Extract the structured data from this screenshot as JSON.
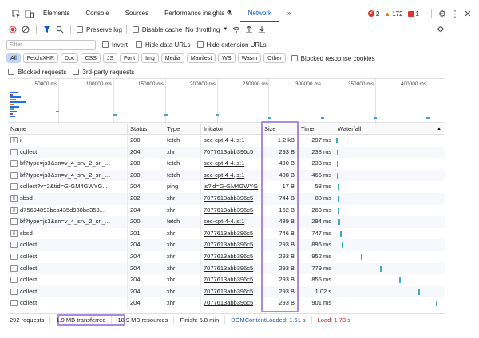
{
  "tabs": [
    "Elements",
    "Console",
    "Sources",
    "Performance insights ⚗",
    "Network"
  ],
  "active_tab": "Network",
  "more_tabs": "»",
  "badges": {
    "errors": "2",
    "warnings": "172",
    "issues": "1"
  },
  "toolbar": {
    "preserve_log": "Preserve log",
    "disable_cache": "Disable cache",
    "throttling": "No throttling"
  },
  "filter": {
    "placeholder": "Filter",
    "invert": "Invert",
    "hide_data_urls": "Hide data URLs",
    "hide_extension_urls": "Hide extension URLs"
  },
  "types": [
    "All",
    "Fetch/XHR",
    "Doc",
    "CSS",
    "JS",
    "Font",
    "Img",
    "Media",
    "Manifest",
    "WS",
    "Wasm",
    "Other"
  ],
  "blocked_response_cookies": "Blocked response cookies",
  "blocked_requests": "Blocked requests",
  "third_party_requests": "3rd-party requests",
  "overview_ticks": [
    "50000 ms",
    "100000 ms",
    "150000 ms",
    "200000 ms",
    "250000 ms",
    "300000 ms",
    "350000 ms",
    "400000 ms"
  ],
  "columns": {
    "name": "Name",
    "status": "Status",
    "type": "Type",
    "initiator": "Initiator",
    "size": "Size",
    "time": "Time",
    "waterfall": "Waterfall"
  },
  "rows": [
    {
      "name": "i",
      "status": "200",
      "type": "fetch",
      "initiator": "sec-cpt-4-4.js:1",
      "size": "1.2 kB",
      "time": "297 ms",
      "icon": "code-icon"
    },
    {
      "name": "collect",
      "status": "204",
      "type": "xhr",
      "initiator": "7077613abb396c5",
      "size": "293 B",
      "time": "238 ms",
      "icon": "doc-icon"
    },
    {
      "name": "bf?type=js3&sn=v_4_srv_2_sn_...",
      "status": "200",
      "type": "fetch",
      "initiator": "sec-cpt-4-4.js:1",
      "size": "490 B",
      "time": "233 ms",
      "icon": "doc-icon"
    },
    {
      "name": "bf?type=js3&sn=v_4_srv_2_sn_...",
      "status": "200",
      "type": "fetch",
      "initiator": "sec-cpt-4-4.js:1",
      "size": "488 B",
      "time": "465 ms",
      "icon": "doc-icon"
    },
    {
      "name": "collect?v=2&tid=G-GM4GWYG...",
      "status": "204",
      "type": "ping",
      "initiator": "js?id=G-GM4GWYG",
      "size": "17 B",
      "time": "58 ms",
      "icon": "doc-icon"
    },
    {
      "name": "sbsd",
      "status": "202",
      "type": "xhr",
      "initiator": "7077613abb396c5",
      "size": "744 B",
      "time": "88 ms",
      "icon": "code-icon"
    },
    {
      "name": "d75694893bca435d930ba353...",
      "status": "204",
      "type": "xhr",
      "initiator": "7077613abb396c5",
      "size": "162 B",
      "time": "263 ms",
      "icon": "code-icon"
    },
    {
      "name": "bf?type=js3&sn=v_4_srv_2_sn_...",
      "status": "200",
      "type": "fetch",
      "initiator": "sec-cpt-4-4.js:1",
      "size": "489 B",
      "time": "294 ms",
      "icon": "doc-icon"
    },
    {
      "name": "sbsd",
      "status": "201",
      "type": "xhr",
      "initiator": "7077613abb396c5",
      "size": "746 B",
      "time": "747 ms",
      "icon": "code-icon"
    },
    {
      "name": "collect",
      "status": "204",
      "type": "xhr",
      "initiator": "7077613abb396c5",
      "size": "293 B",
      "time": "896 ms",
      "icon": "doc-icon"
    },
    {
      "name": "collect",
      "status": "204",
      "type": "xhr",
      "initiator": "7077613abb396c5",
      "size": "293 B",
      "time": "952 ms",
      "icon": "doc-icon"
    },
    {
      "name": "collect",
      "status": "204",
      "type": "xhr",
      "initiator": "7077613abb396c5",
      "size": "293 B",
      "time": "779 ms",
      "icon": "doc-icon"
    },
    {
      "name": "collect",
      "status": "204",
      "type": "xhr",
      "initiator": "7077613abb396c5",
      "size": "293 B",
      "time": "855 ms",
      "icon": "doc-icon"
    },
    {
      "name": "collect",
      "status": "204",
      "type": "xhr",
      "initiator": "7077613abb396c5",
      "size": "293 B",
      "time": "1.02 s",
      "icon": "doc-icon"
    },
    {
      "name": "collect",
      "status": "204",
      "type": "xhr",
      "initiator": "7077613abb396c5",
      "size": "293 B",
      "time": "901 ms",
      "icon": "doc-icon"
    }
  ],
  "statusbar": {
    "requests": "292 requests",
    "transferred": "1.9 MB transferred",
    "resources": "18.9 MB resources",
    "finish": "Finish: 5.8 min",
    "dom_content_loaded": "DOMContentLoaded: 1.61 s",
    "load": "Load: 1.73 s"
  },
  "colors": {
    "accent": "#0b57d0",
    "highlight": "#a78bdf",
    "waterfall": "#3ea9c0",
    "error": "#dc362e",
    "load": "#dc362e",
    "dcl": "#1a73e8"
  }
}
